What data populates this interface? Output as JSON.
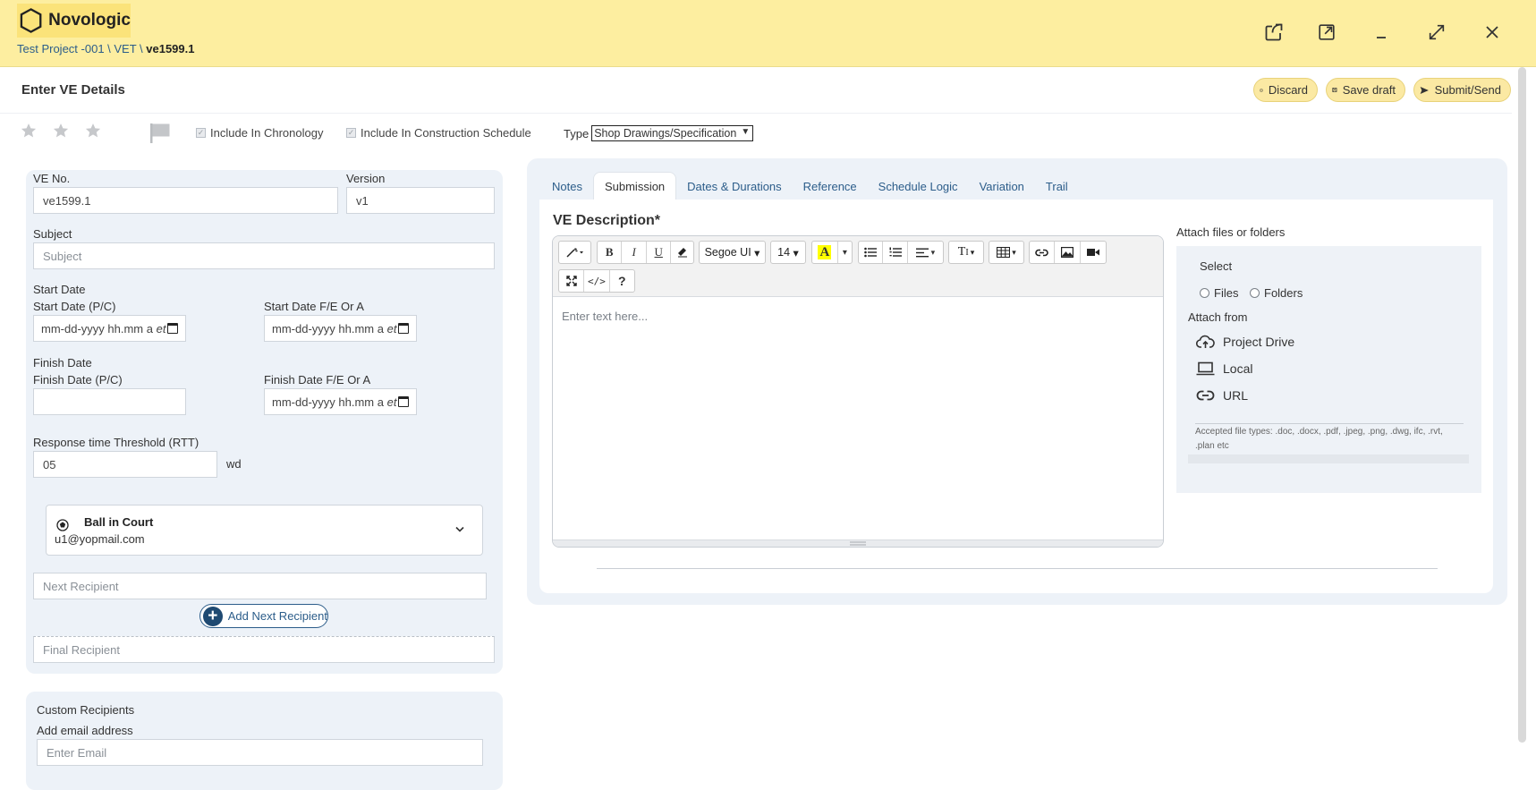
{
  "app": {
    "logo_text": "Novologic",
    "breadcrumb_prefix": "Test Project -001 \\ VET \\ ",
    "breadcrumb_current": "ve1599.1"
  },
  "window_controls": [
    "share-icon",
    "open-external-icon",
    "minimize-icon",
    "maximize-icon",
    "close-icon"
  ],
  "page": {
    "title": "Enter VE Details",
    "actions": {
      "discard": "Discard",
      "save_draft": "Save draft",
      "submit": "Submit/Send"
    }
  },
  "options": {
    "rating": 0,
    "include_chronology": "Include In Chronology",
    "include_construction": "Include In Construction Schedule",
    "type_label": "Type",
    "type_value": "Shop Drawings/Specification"
  },
  "form": {
    "ve_no_label": "VE No.",
    "ve_no_value": "ve1599.1",
    "version_label": "Version",
    "version_value": "v1",
    "subject_label": "Subject",
    "subject_placeholder": "Subject",
    "start_date_heading": "Start Date",
    "start_pc_label": "Start Date (P/C)",
    "start_fe_label": "Start Date F/E Or A",
    "date_placeholder": "mm-dd-yyyy hh.mm a",
    "date_suffix": "et",
    "finish_date_heading": "Finish Date",
    "finish_pc_label": "Finish Date (P/C)",
    "finish_fe_label": "Finish Date F/E Or A",
    "rtt_label": "Response time Threshold (RTT)",
    "rtt_value": "05",
    "rtt_unit": "wd",
    "ball_in_court_title": "Ball in Court",
    "ball_in_court_email": "u1@yopmail.com",
    "next_recipient_placeholder": "Next Recipient",
    "add_next_label": "Add Next Recipient",
    "final_recipient_placeholder": "Final Recipient",
    "custom_recipients_label": "Custom Recipients",
    "add_email_label": "Add email address",
    "email_placeholder": "Enter Email"
  },
  "tabs": [
    {
      "label": "Notes",
      "active": false
    },
    {
      "label": "Submission",
      "active": true
    },
    {
      "label": "Dates & Durations",
      "active": false
    },
    {
      "label": "Reference",
      "active": false
    },
    {
      "label": "Schedule Logic",
      "active": false
    },
    {
      "label": "Variation",
      "active": false
    },
    {
      "label": "Trail",
      "active": false
    }
  ],
  "editor": {
    "heading": "VE Description*",
    "font_name": "Segoe UI",
    "font_size": "14",
    "placeholder": "Enter text here..."
  },
  "attach": {
    "heading": "Attach files or folders",
    "select_label": "Select",
    "files_option": "Files",
    "folders_option": "Folders",
    "from_label": "Attach from",
    "sources": [
      "Project Drive",
      "Local",
      "URL"
    ],
    "accepted_types": "Accepted file types: .doc, .docx, .pdf, .jpeg, .png, .dwg, ifc, .rvt, .plan etc"
  },
  "colors": {
    "header_bg": "#fdeea0",
    "accent_button": "#fbe9a3",
    "panel_bg": "#edf2f8",
    "link": "#2c5d8a"
  }
}
